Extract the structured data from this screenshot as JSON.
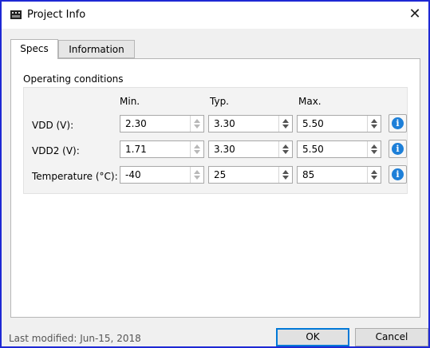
{
  "window": {
    "title": "Project Info",
    "close_glyph": "✕"
  },
  "tabs": [
    {
      "label": "Specs",
      "active": true
    },
    {
      "label": "Information",
      "active": false
    }
  ],
  "group": {
    "title": "Operating conditions",
    "columns": [
      "Min.",
      "Typ.",
      "Max."
    ],
    "rows": [
      {
        "label": "VDD (V):",
        "min": "2.30",
        "typ": "3.30",
        "max": "5.50"
      },
      {
        "label": "VDD2 (V):",
        "min": "1.71",
        "typ": "3.30",
        "max": "5.50"
      },
      {
        "label": "Temperature (°C):",
        "min": "-40",
        "typ": "25",
        "max": "85"
      }
    ],
    "info_glyph": "i"
  },
  "footer": {
    "status": "Last modified: Jun-15, 2018",
    "ok_label": "OK",
    "cancel_label": "Cancel"
  },
  "colors": {
    "accent_border": "#1e28d4",
    "info_blue": "#1d7fd8",
    "default_button_border": "#0078d7"
  }
}
